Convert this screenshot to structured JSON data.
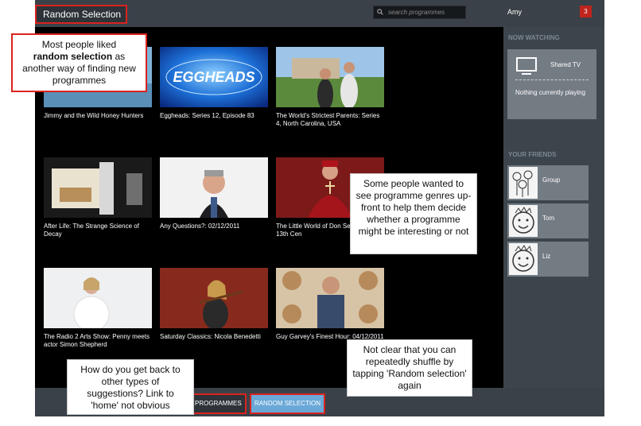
{
  "header": {
    "title": "Random Selection",
    "search_placeholder": "search programmes",
    "user": "Amy",
    "notification_count": "3"
  },
  "sidebar": {
    "now_watching_heading": "NOW WATCHING",
    "device": "Shared TV",
    "status": "Nothing currently playing",
    "friends_heading": "YOUR FRIENDS",
    "friends": [
      {
        "name": "Group"
      },
      {
        "name": "Tom"
      },
      {
        "name": "Liz"
      }
    ]
  },
  "programmes": [
    {
      "title": "Jimmy and the Wild Honey Hunters"
    },
    {
      "title": "Eggheads: Series 12, Episode 83"
    },
    {
      "title": "The World's Strictest Parents: Series 4, North Carolina, USA"
    },
    {
      "title": "After Life: The Strange Science of Decay"
    },
    {
      "title": "Any Questions?: 02/12/2011"
    },
    {
      "title": "The Little World of Don Series 3, The 13th Cen"
    },
    {
      "title": "The Radio 2 Arts Show: Penny meets actor Simon Shepherd"
    },
    {
      "title": "Saturday Classics: Nicola Benedetti"
    },
    {
      "title": "Guy Garvey's Finest Hour: 04/12/2011"
    }
  ],
  "eggheads_logo": "EGGHEADS",
  "footer": {
    "browse": "BROWSE PROGRAMMES",
    "random": "RANDOM SELECTION"
  },
  "annotations": {
    "a_before": "Most people liked",
    "a_bold": "random selection",
    "a_after": "as another way of finding new programmes",
    "b": "Some people wanted to see programme genres up-front to help them decide whether a programme might be interesting or not",
    "c": "Not clear that you can repeatedly shuffle by tapping 'Random selection' again",
    "d": "How do you get back to other types of suggestions? Link to 'home' not obvious"
  },
  "colors": {
    "highlight": "#d9231d",
    "active_tab": "#6aa8d8",
    "chrome": "#3a4148"
  }
}
